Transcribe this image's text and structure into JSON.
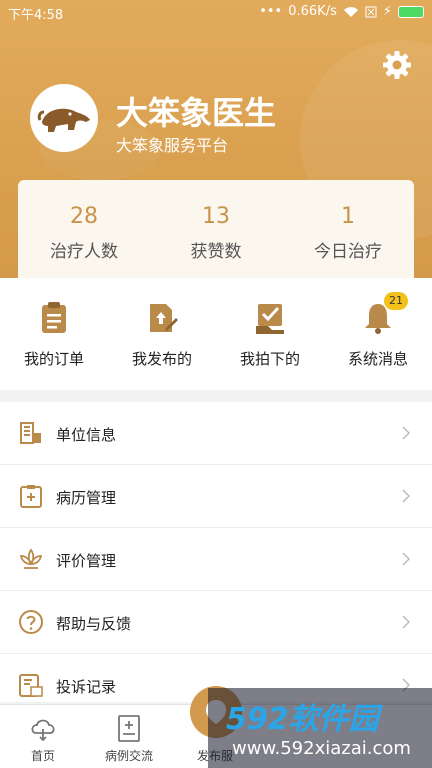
{
  "status_bar": {
    "time": "下午4:58",
    "network_speed": "0.66K/s",
    "battery_color": "#4cd964"
  },
  "profile": {
    "name": "大笨象医生",
    "subtitle": "大笨象服务平台"
  },
  "stats": [
    {
      "value": "28",
      "label": "治疗人数"
    },
    {
      "value": "13",
      "label": "获赞数"
    },
    {
      "value": "1",
      "label": "今日治疗"
    }
  ],
  "quick_actions": [
    {
      "label": "我的订单",
      "icon": "clipboard-icon"
    },
    {
      "label": "我发布的",
      "icon": "publish-doc-icon"
    },
    {
      "label": "我拍下的",
      "icon": "checked-box-icon"
    },
    {
      "label": "系统消息",
      "icon": "bell-icon"
    }
  ],
  "message_badge": "21",
  "menu": [
    {
      "label": "单位信息",
      "icon": "building-icon"
    },
    {
      "label": "病历管理",
      "icon": "medical-record-icon"
    },
    {
      "label": "评价管理",
      "icon": "lotus-icon"
    },
    {
      "label": "帮助与反馈",
      "icon": "help-icon"
    },
    {
      "label": "投诉记录",
      "icon": "complaint-icon"
    }
  ],
  "tabbar": [
    {
      "label": "首页",
      "icon": "home-cloud-icon"
    },
    {
      "label": "病例交流",
      "icon": "case-doc-icon"
    },
    {
      "label": "发布服",
      "icon": "publish-icon"
    }
  ],
  "watermark": {
    "brand": "592软件园",
    "url": "www.592xiazai.com"
  },
  "colors": {
    "accent": "#d9a04f",
    "stat_number": "#c9944a",
    "icon": "#b98a4a"
  }
}
